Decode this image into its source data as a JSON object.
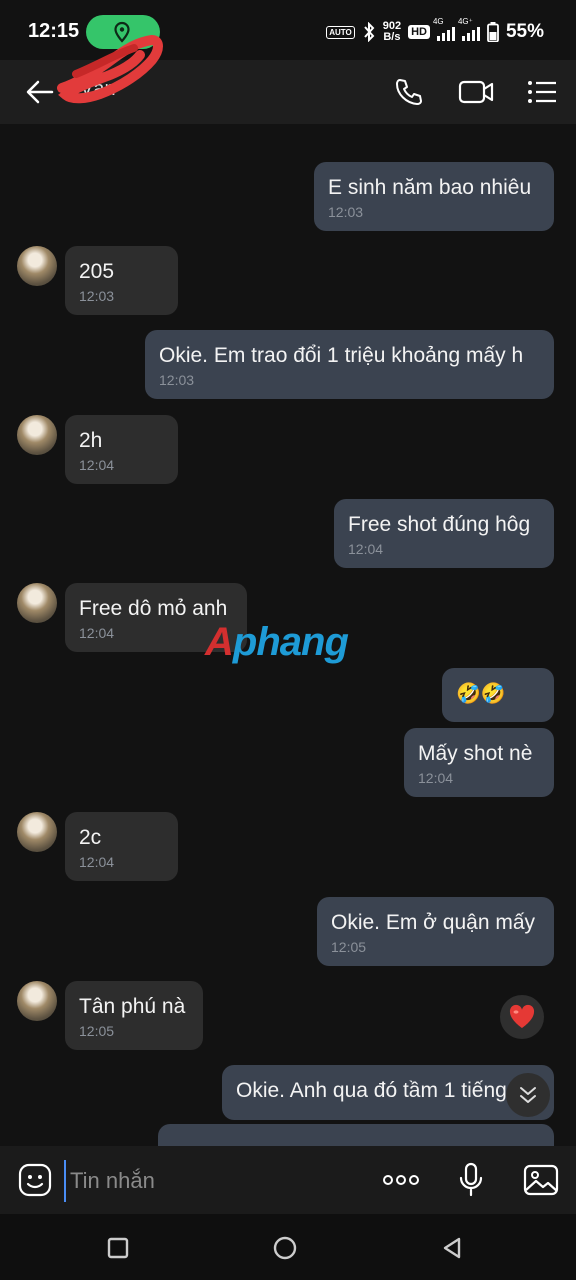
{
  "status_bar": {
    "time": "12:15",
    "net_speed_value": "902",
    "net_speed_unit": "B/s",
    "hd_label": "HD",
    "sim1_tag": "4G",
    "sim2_tag": "4G⁺",
    "battery": "55%",
    "auto_label": "AUTO"
  },
  "header": {
    "contact_name": "Ván"
  },
  "messages": [
    {
      "dir": "out",
      "text": "E sinh năm bao nhiêu",
      "time": "12:03"
    },
    {
      "dir": "in",
      "text": "205",
      "time": "12:03"
    },
    {
      "dir": "out",
      "text": "Okie. Em trao đổi 1 triệu khoảng mấy h",
      "time": "12:03"
    },
    {
      "dir": "in",
      "text": "2h",
      "time": "12:04"
    },
    {
      "dir": "out",
      "text": "Free shot đúng hôg",
      "time": "12:04"
    },
    {
      "dir": "in",
      "text": "Free dô mỏ anh",
      "time": "12:04"
    },
    {
      "dir": "out",
      "text": "🤣🤣",
      "time": ""
    },
    {
      "dir": "out",
      "text": "Mấy shot nè",
      "time": "12:04"
    },
    {
      "dir": "in",
      "text": "2c",
      "time": "12:04"
    },
    {
      "dir": "out",
      "text": "Okie. Em ở quận mấy",
      "time": "12:05"
    },
    {
      "dir": "in",
      "text": "Tân phú nà",
      "time": "12:05"
    },
    {
      "dir": "out",
      "text": "Okie. Anh qua đó tầm 1 tiếng",
      "time": ""
    }
  ],
  "watermark": {
    "part1": "A",
    "part2": "phang"
  },
  "input": {
    "placeholder": "Tin nhắn"
  },
  "colors": {
    "background": "#121212",
    "bubble_in": "#2d2d2d",
    "bubble_out": "#3b4350",
    "location_pill": "#35c56a",
    "heart": "#e53935"
  },
  "icons": {
    "header": [
      "back-arrow-icon",
      "phone-icon",
      "video-call-icon",
      "menu-list-icon"
    ],
    "input": [
      "sticker-icon",
      "more-dots-icon",
      "microphone-icon",
      "gallery-icon"
    ],
    "nav": [
      "recent-apps-icon",
      "home-icon",
      "back-icon"
    ]
  }
}
